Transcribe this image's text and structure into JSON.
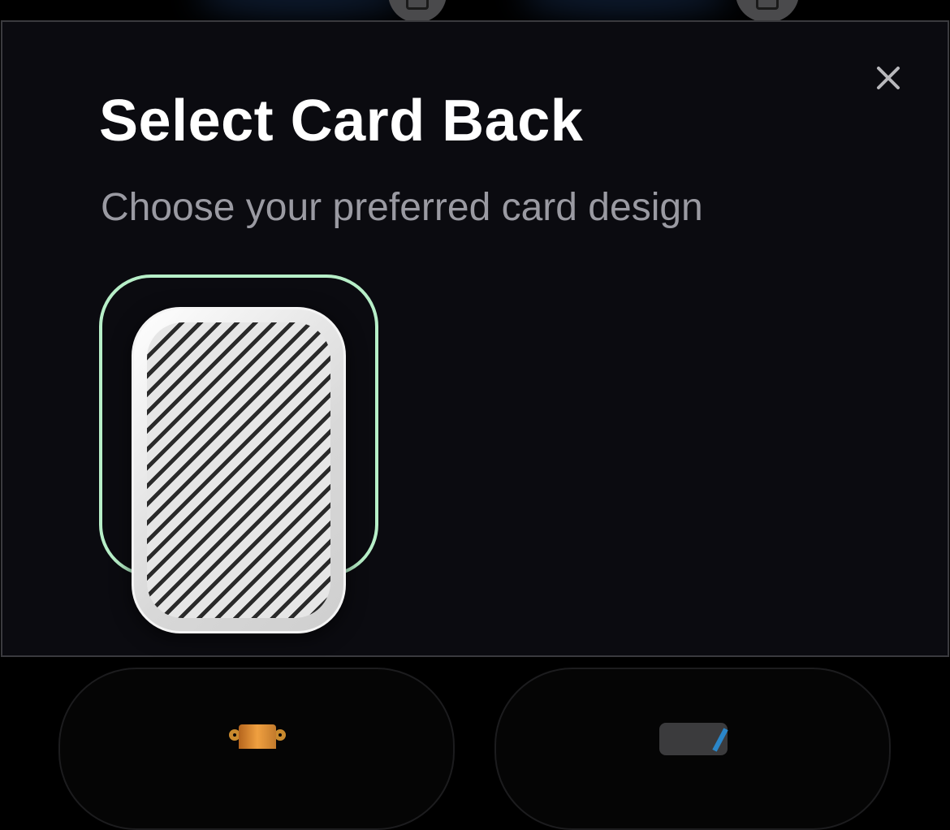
{
  "dialog": {
    "title": "Select Card Back",
    "subtitle": "Choose your preferred card design",
    "close_icon": "close-icon",
    "accent_color": "#b7efc8"
  },
  "card_backs": [
    {
      "icon": "diagonal-stripes",
      "selected": true
    }
  ],
  "background": {
    "icons": [
      "trophy-icon",
      "cards-icon"
    ]
  }
}
